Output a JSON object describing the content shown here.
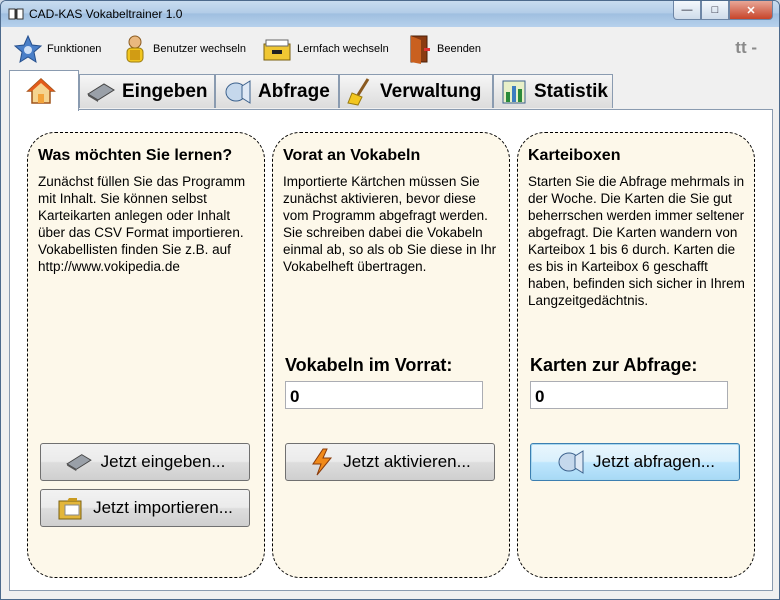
{
  "window": {
    "title": "CAD-KAS Vokabeltrainer 1.0",
    "min_glyph": "—",
    "max_glyph": "□",
    "close_glyph": "✕"
  },
  "toolbar": {
    "items": [
      {
        "label": "Funktionen",
        "icon": "star-functions-icon"
      },
      {
        "label": "Benutzer wechseln",
        "icon": "user-icon"
      },
      {
        "label": "Lernfach wechseln",
        "icon": "file-box-icon"
      },
      {
        "label": "Beenden",
        "icon": "exit-door-icon"
      }
    ],
    "badge": "tt -"
  },
  "tabs": [
    {
      "label": "",
      "icon": "home-icon",
      "active": true
    },
    {
      "label": "Eingeben",
      "icon": "card-input-icon"
    },
    {
      "label": "Abfrage",
      "icon": "query-lamp-icon"
    },
    {
      "label": "Verwaltung",
      "icon": "broom-icon"
    },
    {
      "label": "Statistik",
      "icon": "chart-icon"
    }
  ],
  "cards": {
    "learn": {
      "title": "Was möchten Sie lernen?",
      "text": "Zunächst füllen Sie das Programm mit Inhalt. Sie können selbst Karteikarten anlegen oder Inhalt über das CSV Format importieren. Vokabellisten finden Sie z.B. auf http://www.vokipedia.de",
      "button1": "Jetzt eingeben...",
      "button2": "Jetzt importieren..."
    },
    "stock": {
      "title": "Vorat an Vokabeln",
      "text": "Importierte Kärtchen müssen Sie zunächst aktivieren, bevor diese vom Programm abgefragt werden. Sie schreiben dabei die Vokabeln einmal ab, so als ob Sie diese in Ihr Vokabelheft übertragen.",
      "field_label": "Vokabeln im Vorrat:",
      "field_value": "0",
      "button": "Jetzt aktivieren..."
    },
    "boxes": {
      "title": "Karteiboxen",
      "text": "Starten Sie die Abfrage mehrmals in der Woche. Die Karten die Sie gut beherrschen werden immer seltener abgefragt. Die Karten wandern von Karteibox 1 bis 6 durch. Karten die es bis in Karteibox 6 geschafft haben, befinden sich sicher in Ihrem Langzeitgedächtnis.",
      "field_label": "Karten zur Abfrage:",
      "field_value": "0",
      "button": "Jetzt abfragen..."
    }
  }
}
